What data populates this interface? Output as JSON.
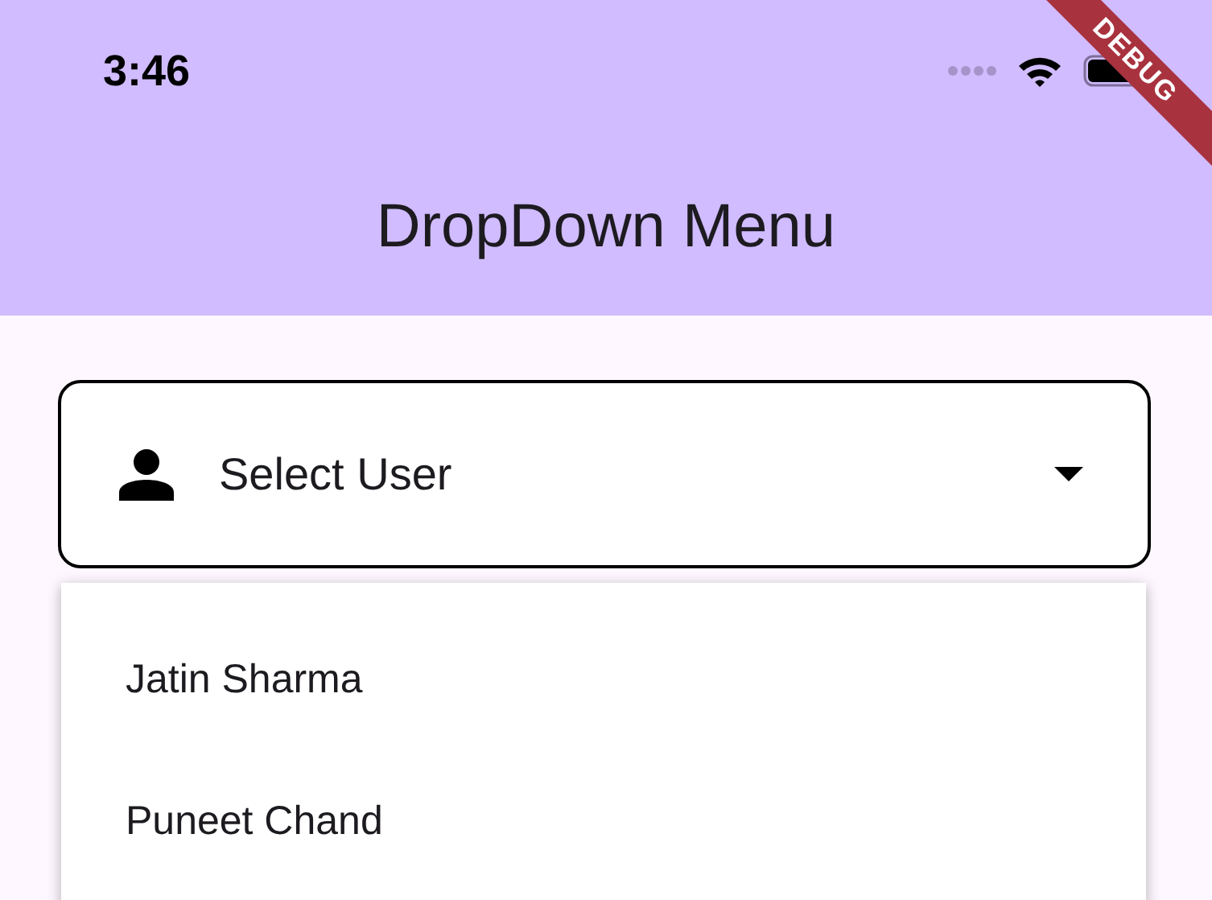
{
  "status_bar": {
    "time": "3:46"
  },
  "debug_banner": "DEBUG",
  "app_bar": {
    "title": "DropDown Menu"
  },
  "dropdown": {
    "placeholder": "Select User",
    "expanded": true
  },
  "menu_items": [
    {
      "label": "Jatin Sharma"
    },
    {
      "label": "Puneet Chand"
    }
  ]
}
